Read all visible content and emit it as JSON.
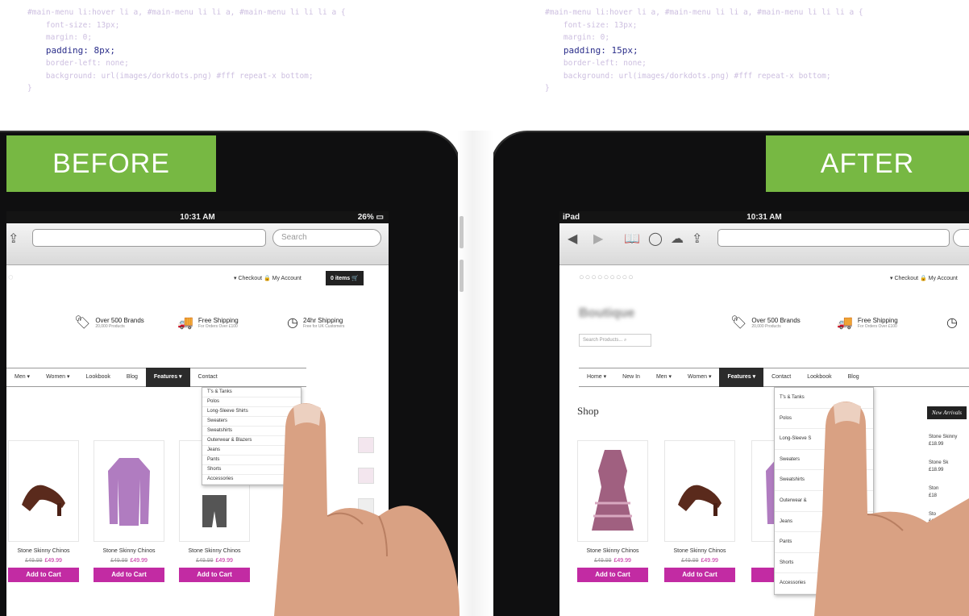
{
  "code_left": {
    "selector": "#main-menu li:hover li a, #main-menu li li a, #main-menu li li li a {",
    "line1": "font-size: 13px;",
    "line2": "margin: 0;",
    "line3": "padding: 8px;",
    "line4": "border-left: none;",
    "line5": "background: url(images/dorkdots.png) #fff repeat-x bottom;",
    "close": "}"
  },
  "code_right": {
    "selector": "#main-menu li:hover li a, #main-menu li li a, #main-menu li li li a {",
    "line1": "font-size: 13px;",
    "line2": "margin: 0;",
    "line3": "padding: 15px;",
    "line4": "border-left: none;",
    "line5": "background: url(images/dorkdots.png) #fff repeat-x bottom;",
    "close": "}"
  },
  "banners": {
    "before": "BEFORE",
    "after": "AFTER"
  },
  "accent": "#77b843",
  "button_color": "#c22ba3",
  "left_ipad": {
    "time": "10:31 AM",
    "battery": "26%",
    "search_placeholder": "Search",
    "account_links": "▾ Checkout  🔒 My Account",
    "basket": "0 items",
    "features": [
      {
        "title": "Over 500 Brands",
        "sub": "20,000 Products"
      },
      {
        "title": "Free Shipping",
        "sub": "For Orders Over £100"
      },
      {
        "title": "24hr Shipping",
        "sub": "Free for UK Customers"
      }
    ],
    "nav": [
      "Men ▾",
      "Women ▾",
      "Lookbook",
      "Blog",
      "Features ▾",
      "Contact"
    ],
    "dropdown": [
      "T's & Tanks",
      "Polos",
      "Long-Sleeve Shirts",
      "Sweaters",
      "Sweatshirts",
      "Outerwear & Blazers",
      "Jeans",
      "Pants",
      "Shorts",
      "Accessories"
    ],
    "products": [
      {
        "name": "Stone Skinny Chinos",
        "old": "£49.99",
        "new": "£49.99",
        "btn": "Add to Cart"
      },
      {
        "name": "Stone Skinny Chinos",
        "old": "£49.99",
        "new": "£49.99",
        "btn": "Add to Cart"
      },
      {
        "name": "Stone Skinny Chinos",
        "old": "£49.99",
        "new": "£49.99",
        "btn": "Add to Cart"
      }
    ]
  },
  "right_ipad": {
    "carrier": "iPad",
    "time": "10:31 AM",
    "account_links": "▾ Checkout  🔒 My Account",
    "search_products": "Search Products...",
    "features": [
      {
        "title": "Over 500 Brands",
        "sub": "20,000 Products"
      },
      {
        "title": "Free Shipping",
        "sub": "For Orders Over £100"
      }
    ],
    "nav": [
      "Home ▾",
      "New In",
      "Men ▾",
      "Women ▾",
      "Features ▾",
      "Contact",
      "Lookbook",
      "Blog"
    ],
    "shop_title": "Shop",
    "new_arrivals": "New Arrivals",
    "side_list": [
      "Stone Skinny",
      "£18.99",
      "Stone Sk",
      "£18.99",
      "Ston",
      "£18",
      "Sto",
      "£1"
    ],
    "dropdown": [
      "T's & Tanks",
      "Polos",
      "Long-Sleeve S",
      "Sweaters",
      "Sweatshirts",
      "Outerwear &",
      "Jeans",
      "Pants",
      "Shorts",
      "Accessories"
    ],
    "products": [
      {
        "name": "Stone Skinny Chinos",
        "old": "£49.99",
        "new": "£49.99",
        "btn": "Add to Cart"
      },
      {
        "name": "Stone Skinny Chinos",
        "old": "£49.99",
        "new": "£49.99",
        "btn": "Add to Cart"
      },
      {
        "name": "Stone",
        "old": "",
        "new": "",
        "btn": "Ad"
      }
    ]
  }
}
